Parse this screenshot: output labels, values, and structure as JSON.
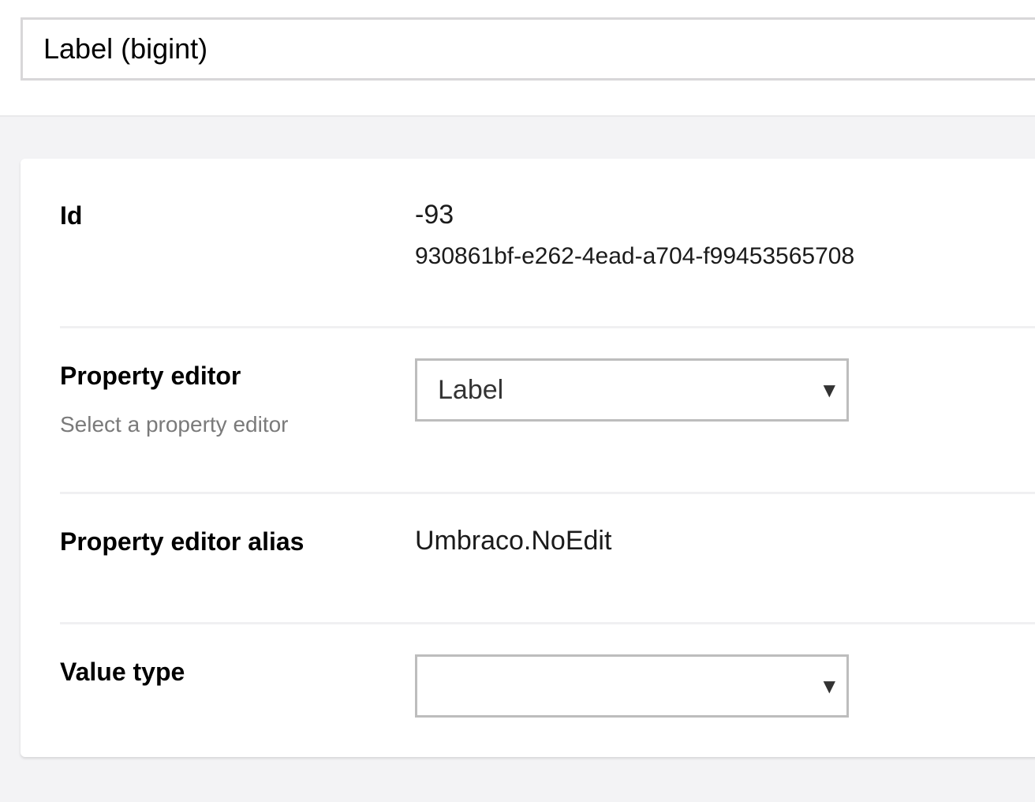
{
  "header": {
    "name_value": "Label (bigint)"
  },
  "properties": {
    "id": {
      "label": "Id",
      "value": "-93",
      "guid": "930861bf-e262-4ead-a704-f99453565708"
    },
    "property_editor": {
      "label": "Property editor",
      "description": "Select a property editor",
      "selected": "Label"
    },
    "property_editor_alias": {
      "label": "Property editor alias",
      "value": "Umbraco.NoEdit"
    },
    "value_type": {
      "label": "Value type",
      "selected": ""
    }
  },
  "icons": {
    "dropdown_caret": "▼"
  }
}
